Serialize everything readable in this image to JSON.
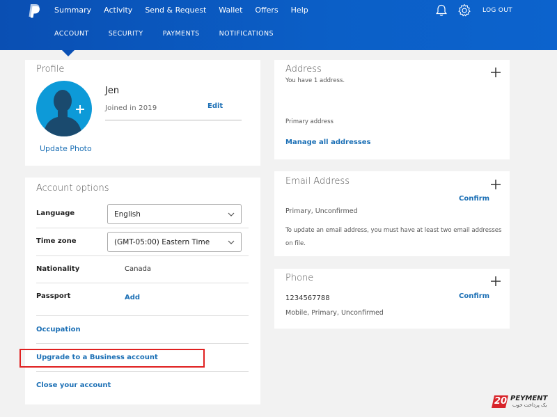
{
  "header": {
    "nav": [
      "Summary",
      "Activity",
      "Send & Request",
      "Wallet",
      "Offers",
      "Help"
    ],
    "logout": "LOG OUT",
    "subnav": [
      "ACCOUNT",
      "SECURITY",
      "PAYMENTS",
      "NOTIFICATIONS"
    ],
    "active_subnav": "ACCOUNT"
  },
  "profile": {
    "title": "Profile",
    "name": "Jen",
    "joined": "Joined in 2019",
    "edit": "Edit",
    "update_photo": "Update Photo"
  },
  "account_options": {
    "title": "Account options",
    "language_label": "Language",
    "language_value": "English",
    "timezone_label": "Time zone",
    "timezone_value": "(GMT-05:00) Eastern Time",
    "nationality_label": "Nationality",
    "nationality_value": "Canada",
    "passport_label": "Passport",
    "passport_action": "Add",
    "occupation": "Occupation",
    "upgrade": "Upgrade to a Business account",
    "close": "Close your account"
  },
  "address": {
    "title": "Address",
    "count_text": "You have 1 address.",
    "primary": "Primary address",
    "manage": "Manage all addresses"
  },
  "email": {
    "title": "Email Address",
    "confirm": "Confirm",
    "status": "Primary, Unconfirmed",
    "note": "To update an email address, you must have at least two email addresses on file."
  },
  "phone": {
    "title": "Phone",
    "confirm": "Confirm",
    "number": "1234567788",
    "status": "Mobile, Primary, Unconfirmed"
  },
  "watermark": {
    "number": "20",
    "brand": "PEYMENT",
    "tagline": "یک پرداخت خوب"
  },
  "colors": {
    "header": "#0a55bb",
    "link": "#1b6fb5",
    "avatar": "#0d9ad8",
    "highlight": "#e02020"
  }
}
